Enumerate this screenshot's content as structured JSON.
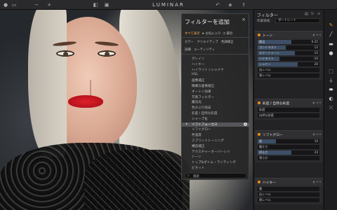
{
  "app": {
    "title": "LUMINAR"
  },
  "topbar": {
    "left_icons": [
      "window-controls-icon",
      "folder-icon",
      "minus-icon",
      "plus-icon",
      "compare-icon",
      "grid-icon"
    ],
    "right_icons": [
      "undo-icon",
      "layers-icon",
      "share-icon"
    ]
  },
  "catalog": {
    "title": "フィルターを追加",
    "close": "×",
    "tabs": [
      "すべて表示",
      "お気に入り",
      "最近"
    ],
    "categories_row1": [
      "カラー",
      "クリエイティブ",
      "色調補正"
    ],
    "categories_row2": [
      "詳細",
      "ユーティリティ"
    ],
    "filters": [
      "グレイン",
      "ハイキー",
      "ハイライト / シャドウ",
      "HSL",
      "画像補正",
      "精細な画像補正",
      "オートン効果",
      "写真フィルター",
      "魔法光",
      "色かぶり除去",
      "彩度 / 自然な彩度",
      "シャープ化",
      "ソフトフォーカス",
      "ソフトグロー",
      "色温度",
      "スプリットトーニング",
      "構造補正",
      "テクスチャーオーバーレイ",
      "トーン",
      "トップ&ボトム・ライティング",
      "ビネット"
    ],
    "selected_index": 12,
    "search_label": "検索"
  },
  "panel": {
    "title": "フィルター",
    "workspace_label": "作業領域:",
    "workspace_value": "ポートレート",
    "sections": [
      {
        "title": "トーン",
        "sliders": [
          {
            "label": "露出",
            "value": "0.25",
            "fill": 0.55
          },
          {
            "label": "コントラスト",
            "value": "12",
            "fill": 0.45
          },
          {
            "label": "スマートトーン",
            "value": "15",
            "fill": 0.6
          },
          {
            "label": "ハイライト",
            "value": "-10",
            "fill": 0.35
          },
          {
            "label": "シャドー",
            "value": "20",
            "fill": 0.65
          },
          {
            "label": "白レベル",
            "value": "",
            "fill": 0.0
          },
          {
            "label": "黒レベル",
            "value": "",
            "fill": 0.0
          }
        ]
      },
      {
        "title": "彩度 / 自然な彩度",
        "sliders": [
          {
            "label": "彩度",
            "value": "",
            "fill": 0.0
          },
          {
            "label": "自然な彩度",
            "value": "",
            "fill": 0.0
          }
        ]
      },
      {
        "title": "ソフトグロー",
        "sliders": [
          {
            "label": "量",
            "value": "10",
            "fill": 0.3
          },
          {
            "label": "暖かさ",
            "value": "",
            "fill": 0.0
          },
          {
            "label": "明るさ",
            "value": "24",
            "fill": 0.55
          },
          {
            "label": "滑らか",
            "value": "",
            "fill": 0.0
          }
        ]
      },
      {
        "title": "ハイキー",
        "sliders": [
          {
            "label": "量",
            "value": "",
            "fill": 0.0
          },
          {
            "label": "白レベル",
            "value": "",
            "fill": 0.0
          },
          {
            "label": "黒レベル",
            "value": "",
            "fill": 0.0
          }
        ]
      }
    ]
  },
  "tools": [
    "brush-icon",
    "paint-icon",
    "layer-icon",
    "radial-icon",
    "crop-icon",
    "clone-stamp-icon",
    "eraser-icon",
    "gradient-icon",
    "transform-icon"
  ],
  "colors": {
    "accent": "#f08c1e",
    "slider_fill": "#3d4f66",
    "panel_bg": "#232325"
  }
}
